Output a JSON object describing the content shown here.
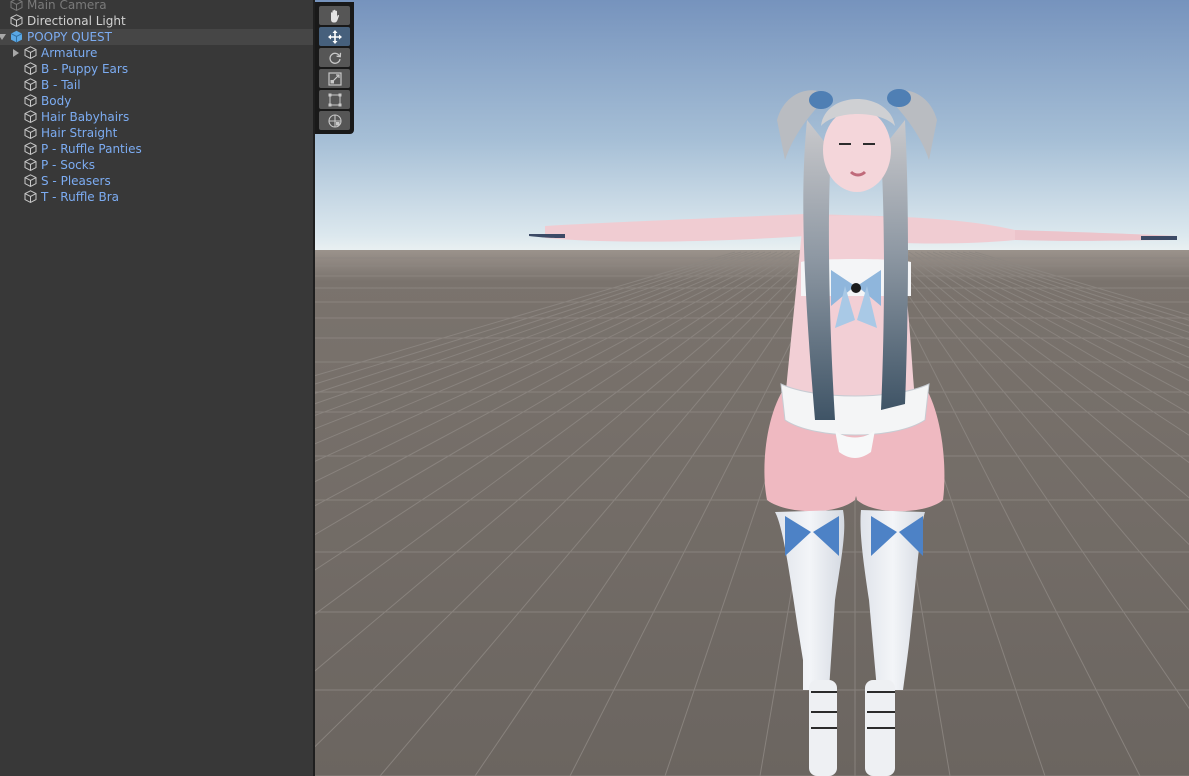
{
  "hierarchy": {
    "items": [
      {
        "label": "Main Camera",
        "style": "dim",
        "icon": "gameobject-icon"
      },
      {
        "label": "Directional Light",
        "style": "normal",
        "icon": "gameobject-icon"
      },
      {
        "label": "POOPY QUEST",
        "style": "prefab-root",
        "icon": "prefab-icon",
        "expanded": true,
        "selected": true
      },
      {
        "label": "Armature",
        "style": "prefab",
        "icon": "gameobject-icon",
        "collapsed": true
      },
      {
        "label": "B - Puppy Ears",
        "style": "prefab",
        "icon": "gameobject-icon"
      },
      {
        "label": "B - Tail",
        "style": "prefab",
        "icon": "gameobject-icon"
      },
      {
        "label": "Body",
        "style": "prefab",
        "icon": "gameobject-icon"
      },
      {
        "label": "Hair Babyhairs",
        "style": "prefab",
        "icon": "gameobject-icon"
      },
      {
        "label": "Hair Straight",
        "style": "prefab",
        "icon": "gameobject-icon"
      },
      {
        "label": "P - Ruffle Panties",
        "style": "prefab",
        "icon": "gameobject-icon"
      },
      {
        "label": "P - Socks",
        "style": "prefab",
        "icon": "gameobject-icon"
      },
      {
        "label": "S - Pleasers",
        "style": "prefab",
        "icon": "gameobject-icon"
      },
      {
        "label": "T - Ruffle Bra",
        "style": "prefab",
        "icon": "gameobject-icon"
      }
    ]
  },
  "tools": {
    "items": [
      {
        "name": "view-tool",
        "icon": "hand-icon",
        "active": false
      },
      {
        "name": "move-tool",
        "icon": "move-arrows-icon",
        "active": true
      },
      {
        "name": "rotate-tool",
        "icon": "rotate-icon",
        "active": false
      },
      {
        "name": "scale-tool",
        "icon": "scale-icon",
        "active": false
      },
      {
        "name": "rect-tool",
        "icon": "rect-transform-icon",
        "active": false
      },
      {
        "name": "transform-tool",
        "icon": "transform-icon",
        "active": false
      }
    ]
  },
  "scene": {
    "sky_top": "#7a98c2",
    "sky_horizon": "#dfe9ef",
    "ground": "#6c6661",
    "grid_line": "#8a8580",
    "avatar_skin": "#f1c8cc",
    "avatar_hair": "#9aa3ad",
    "avatar_accent": "#5a8ccc"
  }
}
